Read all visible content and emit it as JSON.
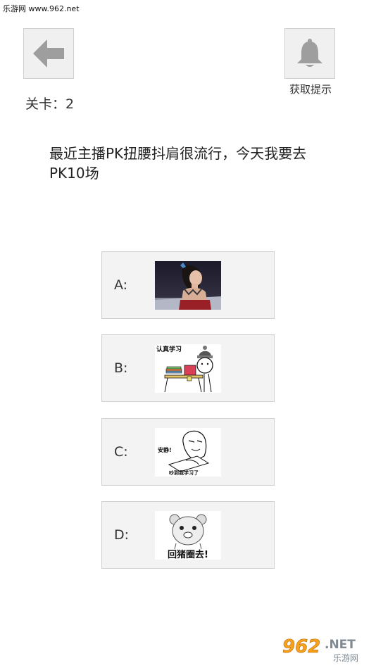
{
  "watermark_top": "乐游网 www.962.net",
  "header": {
    "back_icon": "arrow-left-icon",
    "hint_icon": "bell-icon",
    "hint_label": "获取提示",
    "level_label": "关卡：2"
  },
  "question": "最近主播PK扭腰抖肩很流行，今天我要去PK10场",
  "options": [
    {
      "letter": "A:",
      "image": "girl-photo"
    },
    {
      "letter": "B:",
      "image": "study-meme",
      "caption": "认真学习"
    },
    {
      "letter": "C:",
      "image": "quiet-meme",
      "caption_top": "安静!",
      "caption_bottom": "吵到我学习了"
    },
    {
      "letter": "D:",
      "image": "bear-meme",
      "caption": "回猪圈去!"
    }
  ],
  "logo": {
    "main": "962",
    "suffix": ".NET",
    "sub": "乐游网"
  },
  "colors": {
    "button_bg": "#f0f0f0",
    "icon_gray": "#9e9e9e",
    "option_bg": "#f3f3f3"
  }
}
